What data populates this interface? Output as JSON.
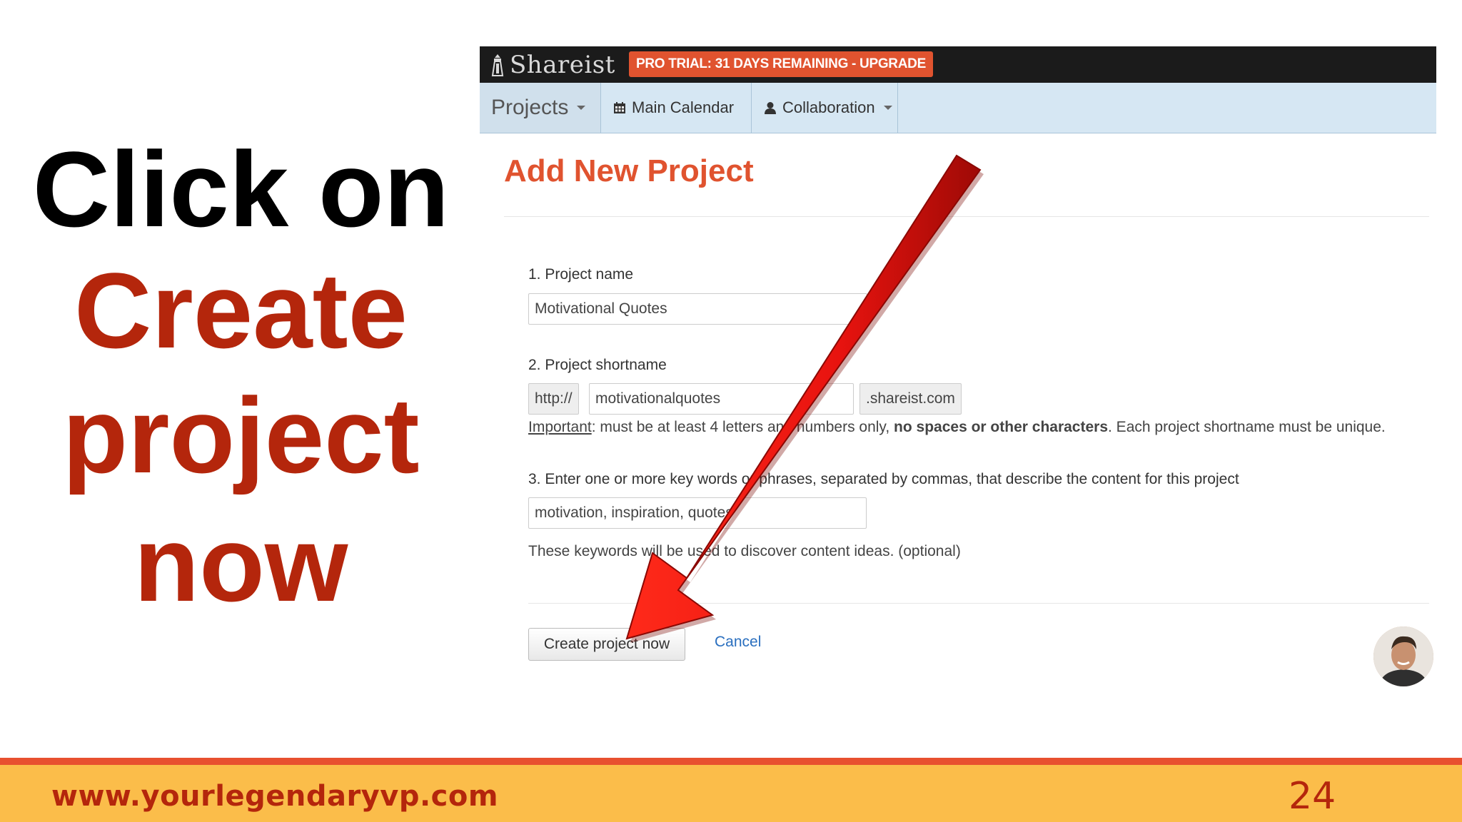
{
  "instruction": {
    "line1": "Click on",
    "line2": "Create",
    "line3": "project",
    "line4": "now"
  },
  "app": {
    "logo_text": "Shareist",
    "pro_badge": "PRO TRIAL: 31 DAYS REMAINING - UPGRADE",
    "nav": {
      "projects": "Projects",
      "calendar": "Main Calendar",
      "collaboration": "Collaboration"
    },
    "page_title": "Add New Project",
    "form": {
      "name_label": "1. Project name",
      "name_value": "Motivational Quotes",
      "shortname_label": "2. Project shortname",
      "shortname_prefix": "http://",
      "shortname_value": "motivationalquotes",
      "shortname_suffix": ".shareist.com",
      "help_important": "Important",
      "help_part1": ": must be at least 4 letters and numbers only, ",
      "help_bold": "no spaces or other characters",
      "help_part2": ". Each project shortname must be unique.",
      "keywords_label": "3. Enter one or more key words or phrases, separated by commas, that describe the content for this project",
      "keywords_value": "motivation, inspiration, quotes",
      "keywords_help": "These keywords will be used to discover content ideas. (optional)",
      "submit_label": "Create project now",
      "cancel_label": "Cancel"
    }
  },
  "footer": {
    "url": "www.yourlegendaryvp.com",
    "page_number": "24"
  },
  "colors": {
    "accent_orange": "#e0532f",
    "instruction_red": "#b4260c",
    "arrow_red": "#e8130f",
    "footer_bg": "#fbbd4a",
    "nav_bg": "#d6e7f3"
  }
}
